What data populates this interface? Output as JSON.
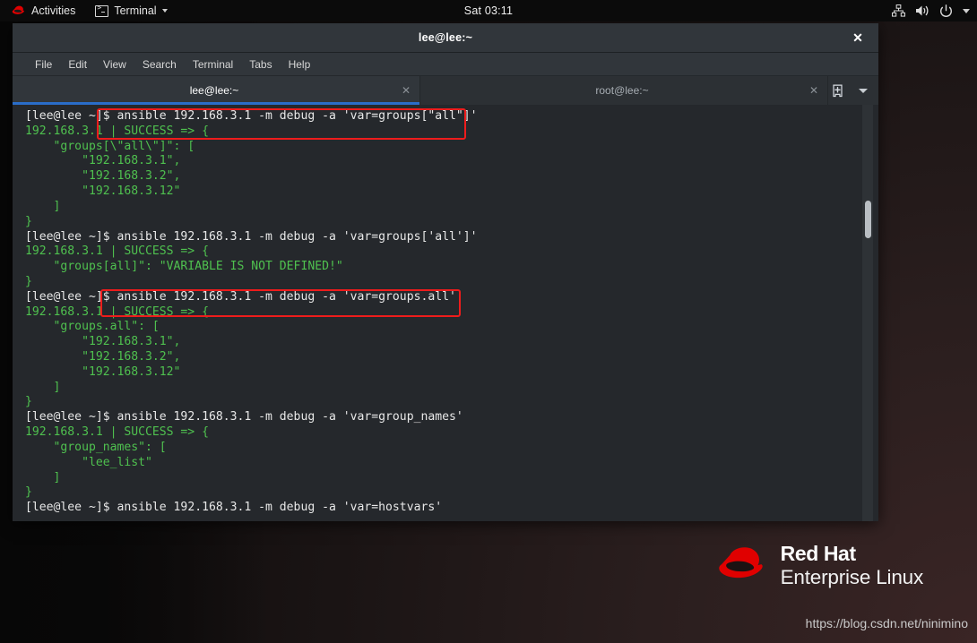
{
  "topbar": {
    "activities_label": "Activities",
    "app_label": "Terminal",
    "clock": "Sat 03:11",
    "tray_icons": [
      "network-icon",
      "volume-icon",
      "power-icon",
      "chevron-down-icon"
    ]
  },
  "window": {
    "title": "lee@lee:~",
    "close_label": "✕",
    "menu": [
      "File",
      "Edit",
      "View",
      "Search",
      "Terminal",
      "Tabs",
      "Help"
    ],
    "tabs": [
      {
        "label": "lee@lee:~",
        "close": "✕",
        "active": true
      },
      {
        "label": "root@lee:~",
        "close": "✕",
        "active": false
      }
    ],
    "new_tab_icon": "new-tab-icon",
    "tab_menu_icon": "chevron-down-icon"
  },
  "terminal": {
    "prompt": "[lee@lee ~]$ ",
    "lines": [
      {
        "type": "prompt",
        "prompt": "[lee@lee ~]$ ",
        "command": "ansible 192.168.3.1 -m debug -a 'var=groups[\"all\"]'"
      },
      {
        "type": "out",
        "text": "192.168.3.1 | SUCCESS => {"
      },
      {
        "type": "out",
        "text": "    \"groups[\\\"all\\\"]\": ["
      },
      {
        "type": "out",
        "text": "        \"192.168.3.1\","
      },
      {
        "type": "out",
        "text": "        \"192.168.3.2\","
      },
      {
        "type": "out",
        "text": "        \"192.168.3.12\""
      },
      {
        "type": "out",
        "text": "    ]"
      },
      {
        "type": "out",
        "text": "}"
      },
      {
        "type": "prompt",
        "prompt": "[lee@lee ~]$ ",
        "command": "ansible 192.168.3.1 -m debug -a 'var=groups['all']'"
      },
      {
        "type": "out",
        "text": "192.168.3.1 | SUCCESS => {"
      },
      {
        "type": "out",
        "text": "    \"groups[all]\": \"VARIABLE IS NOT DEFINED!\""
      },
      {
        "type": "out",
        "text": "}"
      },
      {
        "type": "prompt",
        "prompt": "[lee@lee ~]$ ",
        "command": "ansible 192.168.3.1 -m debug -a 'var=groups.all'"
      },
      {
        "type": "out",
        "text": "192.168.3.1 | SUCCESS => {"
      },
      {
        "type": "out",
        "text": "    \"groups.all\": ["
      },
      {
        "type": "out",
        "text": "        \"192.168.3.1\","
      },
      {
        "type": "out",
        "text": "        \"192.168.3.2\","
      },
      {
        "type": "out",
        "text": "        \"192.168.3.12\""
      },
      {
        "type": "out",
        "text": "    ]"
      },
      {
        "type": "out",
        "text": "}"
      },
      {
        "type": "prompt",
        "prompt": "[lee@lee ~]$ ",
        "command": "ansible 192.168.3.1 -m debug -a 'var=group_names'"
      },
      {
        "type": "out",
        "text": "192.168.3.1 | SUCCESS => {"
      },
      {
        "type": "out",
        "text": "    \"group_names\": ["
      },
      {
        "type": "out",
        "text": "        \"lee_list\""
      },
      {
        "type": "out",
        "text": "    ]"
      },
      {
        "type": "out",
        "text": "}"
      },
      {
        "type": "prompt",
        "prompt": "[lee@lee ~]$ ",
        "command": "ansible 192.168.3.1 -m debug -a 'var=hostvars'"
      }
    ]
  },
  "brand": {
    "line1": "Red Hat",
    "line2": "Enterprise Linux"
  },
  "watermark": "https://blog.csdn.net/ninimino",
  "colors": {
    "accent_blue": "#2a6dc9",
    "annotation_red": "#ee1c1c",
    "redhat_red": "#e00000",
    "terminal_green": "#4fc14f",
    "terminal_bg": "#25282c"
  }
}
